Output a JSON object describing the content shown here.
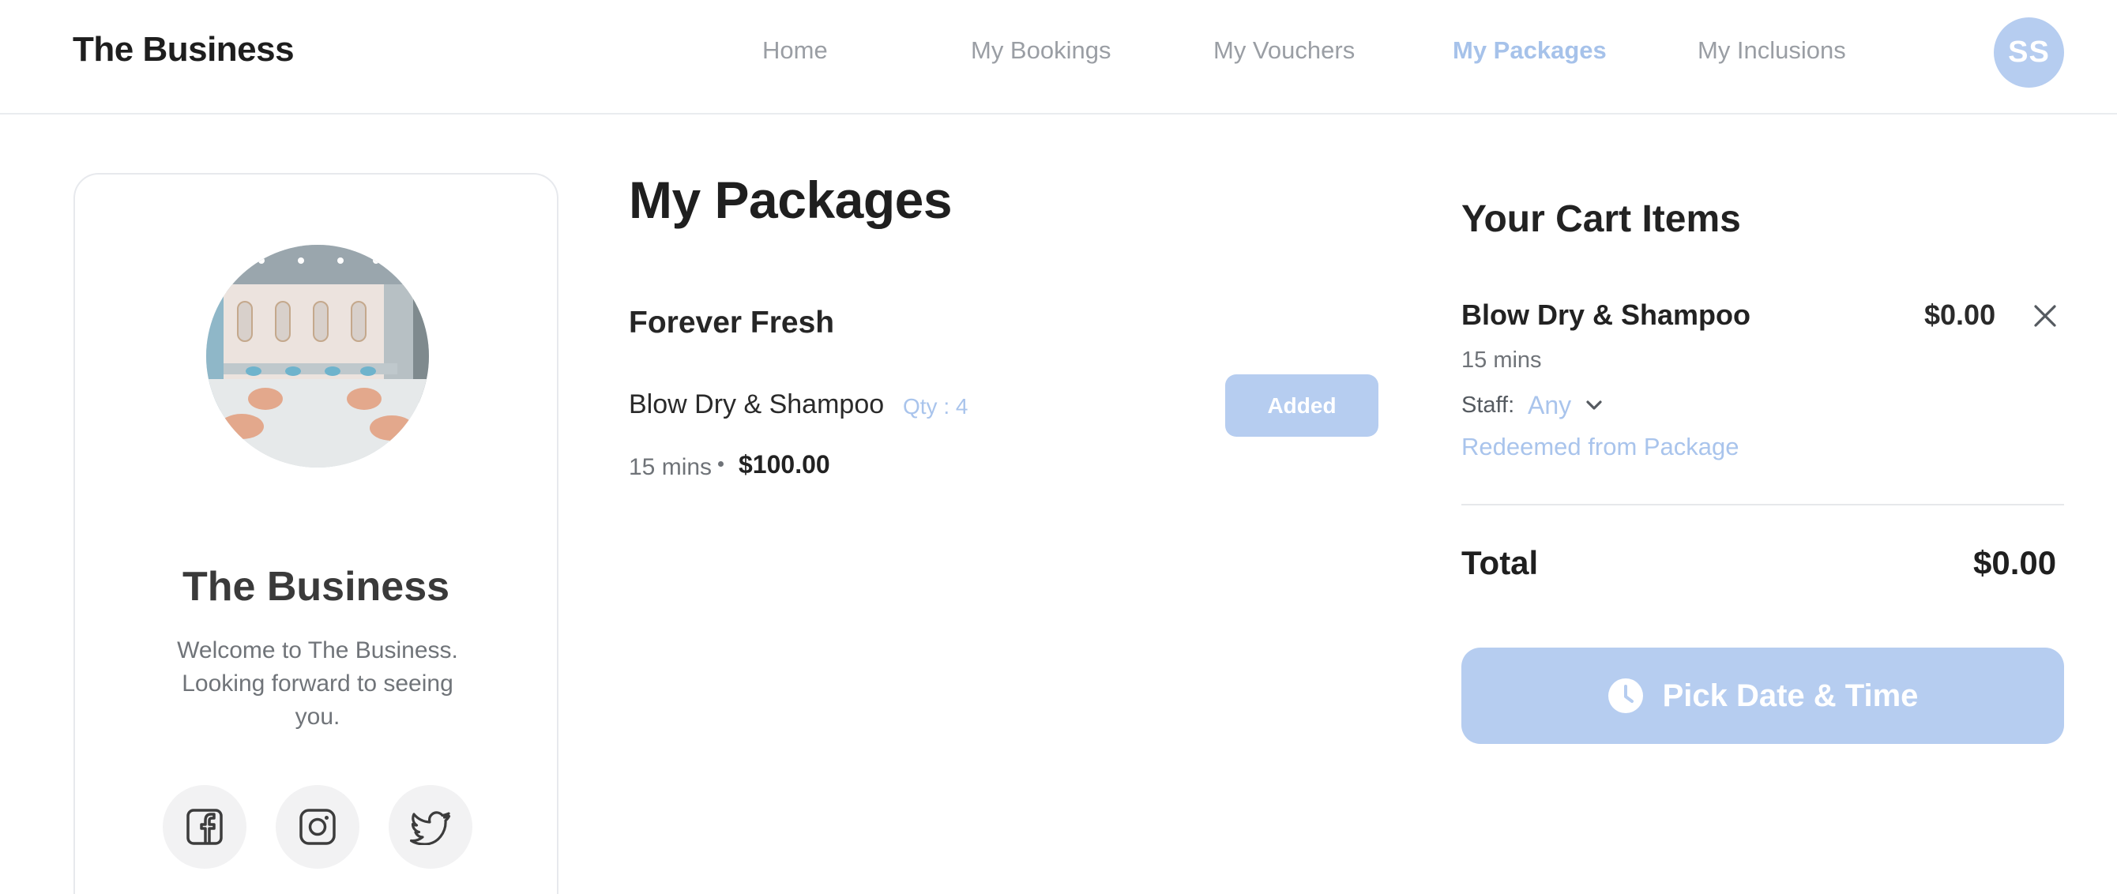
{
  "header": {
    "brand": "The Business",
    "nav": [
      {
        "label": "Home",
        "active": false
      },
      {
        "label": "My Bookings",
        "active": false
      },
      {
        "label": "My Vouchers",
        "active": false
      },
      {
        "label": "My Packages",
        "active": true
      },
      {
        "label": "My Inclusions",
        "active": false
      }
    ],
    "avatar_initials": "SS"
  },
  "profile": {
    "name": "The Business",
    "welcome": "Welcome to The Business. Looking forward to seeing you.",
    "social": [
      {
        "icon": "facebook-icon"
      },
      {
        "icon": "instagram-icon"
      },
      {
        "icon": "twitter-icon"
      }
    ]
  },
  "main": {
    "title": "My Packages",
    "packages": [
      {
        "name": "Forever Fresh",
        "services": [
          {
            "name": "Blow Dry & Shampoo",
            "qty_label": "Qty : 4",
            "button_label": "Added",
            "duration": "15 mins",
            "price": "$100.00"
          }
        ]
      }
    ]
  },
  "cart": {
    "title": "Your Cart Items",
    "items": [
      {
        "name": "Blow Dry & Shampoo",
        "price": "$0.00",
        "duration": "15 mins",
        "staff_label": "Staff:",
        "staff_value": "Any",
        "note": "Redeemed from Package"
      }
    ],
    "total_label": "Total",
    "total_value": "$0.00",
    "pick_button_label": "Pick Date & Time"
  },
  "colors": {
    "accent": "#a9c4ec",
    "accent_button": "#b6cdf0",
    "text_dark": "#222222",
    "text_muted": "#6f7378"
  }
}
